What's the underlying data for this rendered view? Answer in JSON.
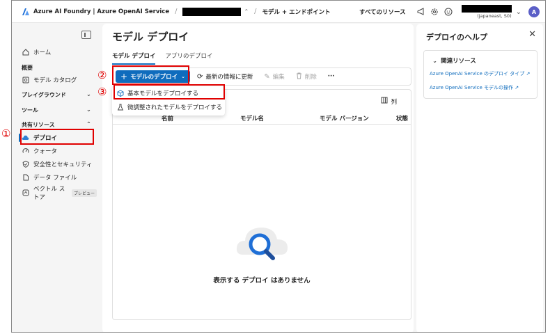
{
  "topbar": {
    "brand": "Azure AI Foundry | Azure OpenAI Service",
    "breadcrumb_sep": "/",
    "breadcrumb_page": "モデル + エンドポイント",
    "all_resources": "すべてのリソース",
    "account_region": "(japaneast, S0)",
    "avatar_letter": "A"
  },
  "sidebar": {
    "home": "ホーム",
    "overview_group": "概要",
    "model_catalog": "モデル カタログ",
    "playground_group": "プレイグラウンド",
    "tools_group": "ツール",
    "shared_group": "共有リソース",
    "deploy": "デプロイ",
    "quota": "クォータ",
    "safety": "安全性とセキュリティ",
    "data_files": "データ ファイル",
    "vector_store_line1": "ベクトル ス",
    "vector_store_line2": "トア",
    "preview_badge": "プレビュー"
  },
  "main": {
    "title": "モデル デプロイ",
    "tabs": [
      {
        "label": "モデル デプロイ",
        "active": true
      },
      {
        "label": "アプリのデプロイ",
        "active": false
      }
    ],
    "toolbar": {
      "deploy_model": "モデルのデプロイ",
      "refresh": "最新の情報に更新",
      "edit": "編集",
      "delete": "削除",
      "more": "···"
    },
    "columns_button": "列",
    "table_headers": [
      "名前",
      "モデル名",
      "モデル バージョン",
      "状態"
    ],
    "empty_text": "表示する デプロイ はありません"
  },
  "dropdown_menu": {
    "items": [
      {
        "label": "基本モデルをデプロイする",
        "icon": "cube-icon"
      },
      {
        "label": "微調整されたモデルをデプロイする",
        "icon": "flask-icon"
      }
    ]
  },
  "help_panel": {
    "title": "デプロイのヘルプ",
    "section": "関連リソース",
    "links": [
      "Azure OpenAI Service のデプロイ タイプ",
      "Azure OpenAI Service モデルの操作"
    ]
  },
  "annotations": {
    "step1": "①",
    "step2": "②",
    "step3": "③"
  },
  "colors": {
    "accent": "#0f6cbd",
    "annotation_red": "#e00000",
    "avatar": "#5b5fc7"
  }
}
